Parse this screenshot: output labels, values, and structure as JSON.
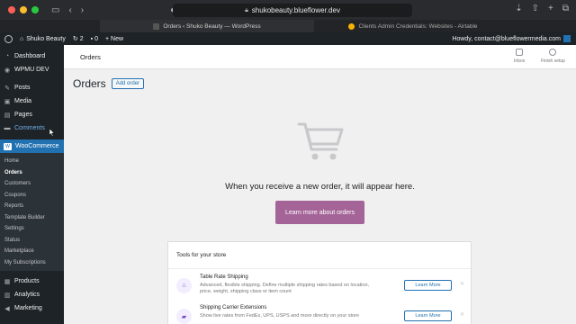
{
  "browser": {
    "url": "shukobeauty.blueflower.dev",
    "tabs": [
      {
        "label": "Orders ‹ Shuko Beauty — WordPress"
      },
      {
        "label": "Clients Admin Credentials: Websites - Airtable"
      }
    ]
  },
  "adminbar": {
    "site_name": "Shuko Beauty",
    "updates_count": "2",
    "comments_count": "0",
    "new_label": "+ New",
    "greeting": "Howdy, contact@blueflowermedia.com"
  },
  "sidebar": {
    "items": [
      {
        "label": "Dashboard",
        "icon": "dashboard-icon"
      },
      {
        "label": "WPMU DEV",
        "icon": "wpmudev-icon"
      },
      {
        "label": "Posts",
        "icon": "pin-icon"
      },
      {
        "label": "Media",
        "icon": "media-icon"
      },
      {
        "label": "Pages",
        "icon": "pages-icon"
      },
      {
        "label": "Comments",
        "icon": "comment-icon"
      },
      {
        "label": "WooCommerce",
        "icon": "woo-icon"
      }
    ],
    "submenu": [
      "Home",
      "Orders",
      "Customers",
      "Coupons",
      "Reports",
      "Template Builder",
      "Settings",
      "Status",
      "Marketplace",
      "My Subscriptions"
    ],
    "bottom_items": [
      {
        "label": "Products",
        "icon": "box-icon"
      },
      {
        "label": "Analytics",
        "icon": "chart-icon"
      },
      {
        "label": "Marketing",
        "icon": "megaphone-icon"
      }
    ]
  },
  "header": {
    "title": "Orders",
    "inbox_label": "Inbox",
    "finish_setup_label": "Finish setup"
  },
  "page": {
    "title": "Orders",
    "add_order_label": "Add order",
    "empty_message": "When you receive a new order, it will appear here.",
    "learn_more_orders_label": "Learn more about orders"
  },
  "tools": {
    "title": "Tools for your store",
    "items": [
      {
        "name": "Table Rate Shipping",
        "description": "Advanced, flexible shipping. Define multiple shipping rates based on location, price, weight, shipping class or item count",
        "button": "Learn More"
      },
      {
        "name": "Shipping Carrier Extensions",
        "description": "Show live rates from FedEx, UPS, USPS and more directly on your store",
        "button": "Learn More"
      }
    ]
  },
  "colors": {
    "wp_admin_dark": "#1d2327",
    "wp_blue": "#2271b1",
    "woo_purple": "#a46497"
  }
}
